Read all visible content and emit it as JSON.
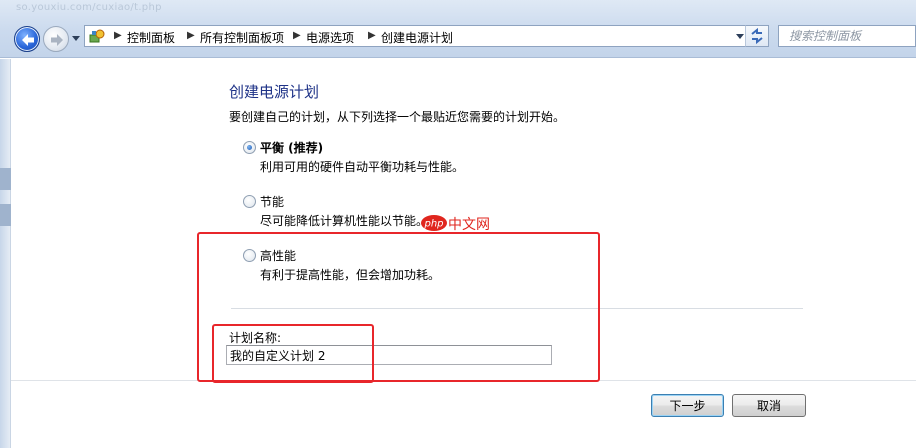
{
  "address_bar": {
    "faint_text": "so.youxiu.com/cuxiao/t.php",
    "breadcrumbs": [
      "控制面板",
      "所有控制面板项",
      "电源选项",
      "创建电源计划"
    ]
  },
  "search": {
    "placeholder": "搜索控制面板"
  },
  "page": {
    "title": "创建电源计划",
    "intro": "要创建自己的计划，从下列选择一个最贴近您需要的计划开始。"
  },
  "options": [
    {
      "label": "平衡 (推荐)",
      "description": "利用可用的硬件自动平衡功耗与性能。",
      "checked": true
    },
    {
      "label": "节能",
      "description": "尽可能降低计算机性能以节能。",
      "checked": false
    },
    {
      "label": "高性能",
      "description": "有利于提高性能，但会增加功耗。",
      "checked": false
    }
  ],
  "plan_name": {
    "label": "计划名称:",
    "value": "我的自定义计划 2"
  },
  "buttons": {
    "next": "下一步",
    "cancel": "取消"
  },
  "watermark": {
    "logo": "php",
    "text": "中文网"
  },
  "colors": {
    "accent_title": "#1e3287",
    "annotation": "#e8262b",
    "watermark": "#e0261e"
  },
  "icons": [
    "back-arrow-icon",
    "forward-arrow-icon",
    "chevron-down-icon",
    "control-panel-icon",
    "refresh-icon"
  ]
}
